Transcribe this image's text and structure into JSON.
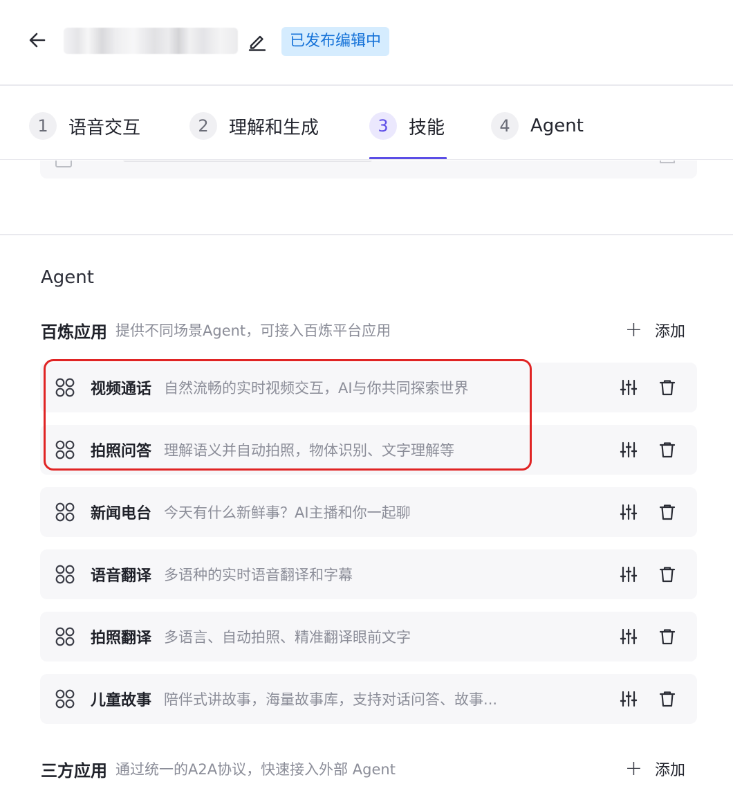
{
  "header": {
    "back_icon": "arrow-left-icon",
    "edit_icon": "pencil-icon",
    "status_badge": "已发布编辑中",
    "badge_colors": {
      "background": "#d5ecfe",
      "text": "#1572d8"
    }
  },
  "tabs": [
    {
      "num": "1",
      "label": "语音交互"
    },
    {
      "num": "2",
      "label": "理解和生成"
    },
    {
      "num": "3",
      "label": "技能",
      "active": true
    },
    {
      "num": "4",
      "label": "Agent"
    }
  ],
  "accent_color": "#5b4ee6",
  "section": {
    "title": "Agent",
    "bailian": {
      "title": "百炼应用",
      "desc": "提供不同场景Agent，可接入百炼平台应用",
      "add_label": "添加",
      "items": [
        {
          "title": "视频通话",
          "desc": "自然流畅的实时视频交互，AI与你共同探索世界"
        },
        {
          "title": "拍照问答",
          "desc": "理解语义并自动拍照，物体识别、文字理解等"
        },
        {
          "title": "新闻电台",
          "desc": "今天有什么新鲜事？AI主播和你一起聊"
        },
        {
          "title": "语音翻译",
          "desc": "多语种的实时语音翻译和字幕"
        },
        {
          "title": "拍照翻译",
          "desc": "多语言、自动拍照、精准翻译眼前文字"
        },
        {
          "title": "儿童故事",
          "desc": "陪伴式讲故事，海量故事库，支持对话问答、故事..."
        }
      ]
    },
    "third_party": {
      "title": "三方应用",
      "desc": "通过统一的A2A协议，快速接入外部 Agent",
      "add_label": "添加"
    }
  },
  "highlight_color": "#e02424"
}
